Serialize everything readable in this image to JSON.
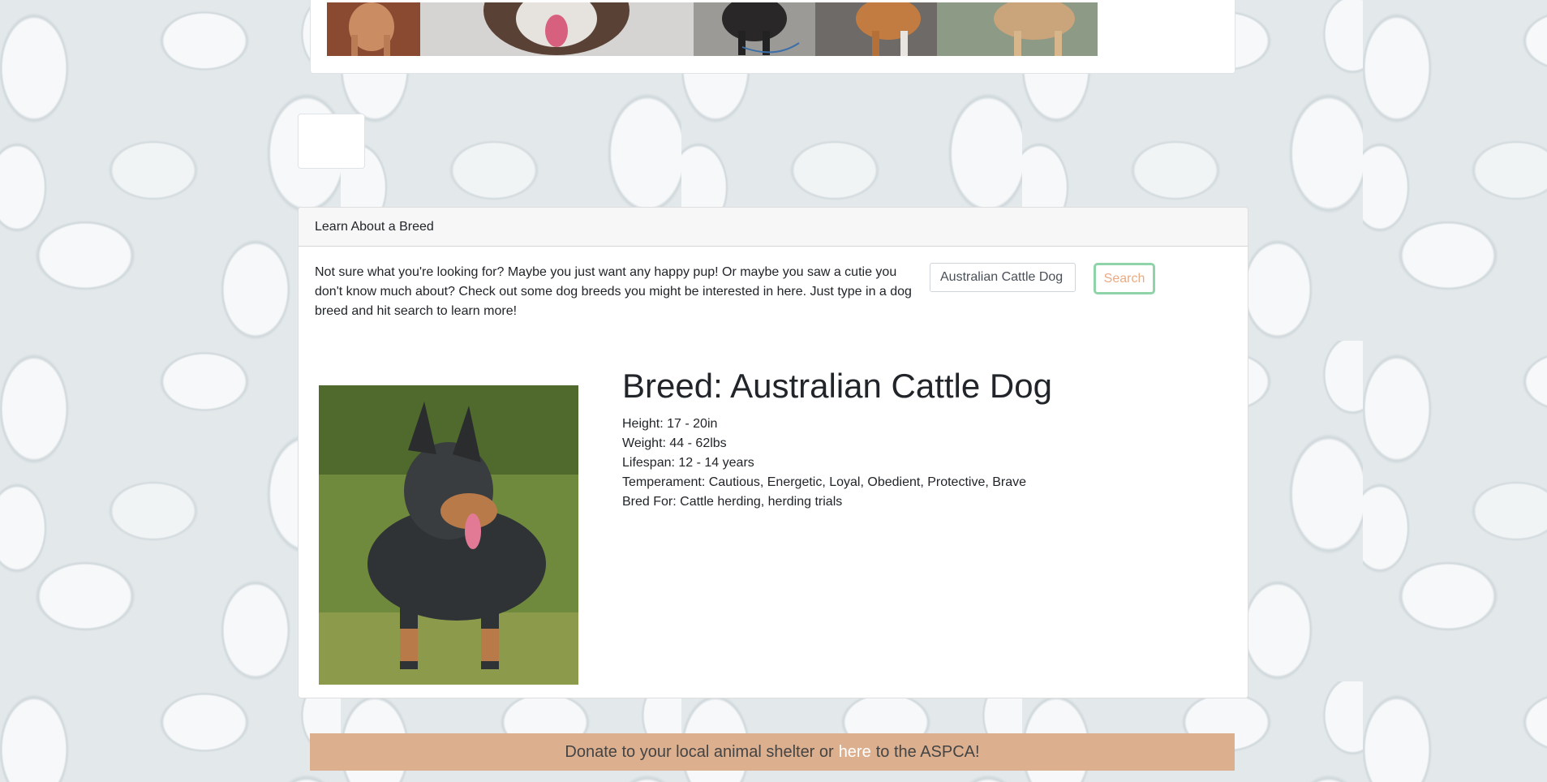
{
  "gallery": {
    "photos": [
      "dog-photo-1",
      "dog-photo-2",
      "dog-photo-3",
      "dog-photo-4",
      "dog-photo-5"
    ]
  },
  "breed_card": {
    "header": "Learn About a Breed",
    "intro": "Not sure what you're looking for? Maybe you just want any happy pup! Or maybe you saw a cutie you don't know much about? Check out some dog breeds you might be interested in here. Just type in a dog breed and hit search to learn more!",
    "search_value": "Australian Cattle Dog",
    "search_label": "Search",
    "title": "Breed: Australian Cattle Dog",
    "height": "Height: 17 - 20in",
    "weight": "Weight: 44 - 62lbs",
    "lifespan": "Lifespan: 12 - 14 years",
    "temperament": "Temperament: Cautious, Energetic, Loyal, Obedient, Protective, Brave",
    "bred_for": "Bred For: Cattle herding, herding trials"
  },
  "footer": {
    "text_before": "Donate to your local animal shelter or",
    "link": "here",
    "text_after": "to the ASPCA!"
  },
  "colors": {
    "search_border": "#8fd3a9",
    "search_text": "#e9ab84",
    "donate_bg": "#dcb08f"
  }
}
